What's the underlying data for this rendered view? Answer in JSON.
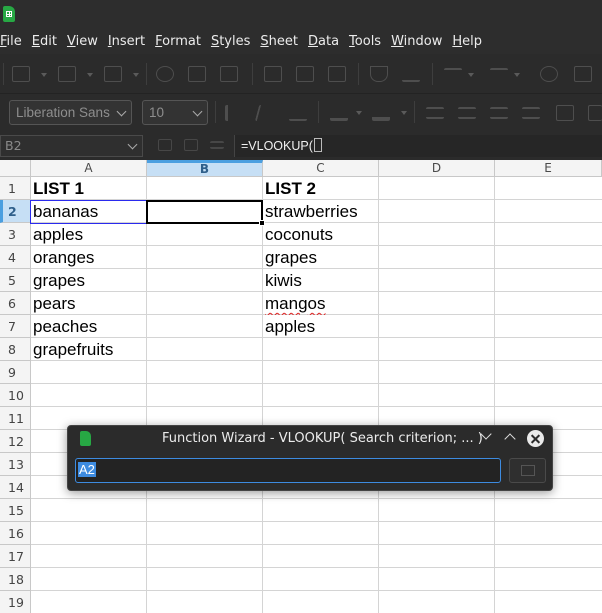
{
  "menu": [
    {
      "underline": "F",
      "rest": "ile"
    },
    {
      "underline": "E",
      "rest": "dit"
    },
    {
      "underline": "V",
      "rest": "iew"
    },
    {
      "underline": "I",
      "rest": "nsert"
    },
    {
      "underline": "F",
      "rest": "ormat",
      "pre": ""
    },
    {
      "underline": "S",
      "rest": "tyles"
    },
    {
      "underline": "S",
      "rest": "heet"
    },
    {
      "underline": "D",
      "rest": "ata"
    },
    {
      "underline": "T",
      "rest": "ools"
    },
    {
      "underline": "W",
      "rest": "indow"
    },
    {
      "underline": "H",
      "rest": "elp"
    }
  ],
  "font_name": "Liberation Sans",
  "font_size": "10",
  "name_box": "B2",
  "formula": "=VLOOKUP(",
  "columns": [
    "A",
    "B",
    "C",
    "D",
    "E"
  ],
  "rows": [
    "1",
    "2",
    "3",
    "4",
    "5",
    "6",
    "7",
    "8",
    "9",
    "10",
    "11",
    "12",
    "13",
    "14",
    "15",
    "16",
    "17",
    "18",
    "19"
  ],
  "active_cell": {
    "column": "B",
    "row": "2"
  },
  "column_a": [
    "LIST 1",
    "bananas",
    "apples",
    "oranges",
    "grapes",
    "pears",
    "peaches",
    "grapefruits"
  ],
  "column_c": [
    "LIST 2",
    "strawberries",
    "coconuts",
    "grapes",
    "kiwis",
    "mangos",
    "apples"
  ],
  "dialog": {
    "title": "Function Wizard - VLOOKUP( Search criterion; ... )",
    "input_value": "A2"
  },
  "colors": {
    "accent": "#3d8be0",
    "app_green": "#27a844",
    "ref_border": "#2a2aee",
    "spell_error": "#e02020"
  }
}
